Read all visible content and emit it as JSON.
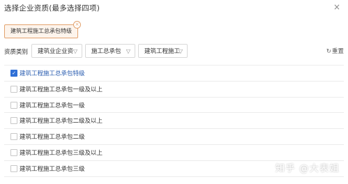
{
  "dialog": {
    "title": "选择企业资质(最多选择四项)",
    "close_icon": "close-icon"
  },
  "selected_tags": [
    {
      "label": "建筑工程施工总承包特级"
    }
  ],
  "filters": {
    "label": "资质类别",
    "selects": [
      {
        "value": "建筑业企业资"
      },
      {
        "value": "施工总承包"
      },
      {
        "value": "建筑工程施工"
      }
    ],
    "reset_label": "重置",
    "reset_icon": "refresh-icon"
  },
  "qualifications": [
    {
      "label": "建筑工程施工总承包特级",
      "checked": true
    },
    {
      "label": "建筑工程施工总承包一级及以上",
      "checked": false
    },
    {
      "label": "建筑工程施工总承包一级",
      "checked": false
    },
    {
      "label": "建筑工程施工总承包二级及以上",
      "checked": false
    },
    {
      "label": "建筑工程施工总承包二级",
      "checked": false
    },
    {
      "label": "建筑工程施工总承包三级及以上",
      "checked": false
    },
    {
      "label": "建筑工程施工总承包三级",
      "checked": false
    }
  ],
  "watermark": "知乎 @大表姐",
  "colors": {
    "accent": "#2f6fd6",
    "tag_border": "#e3a36f",
    "tag_background": "#fdf4ec"
  }
}
